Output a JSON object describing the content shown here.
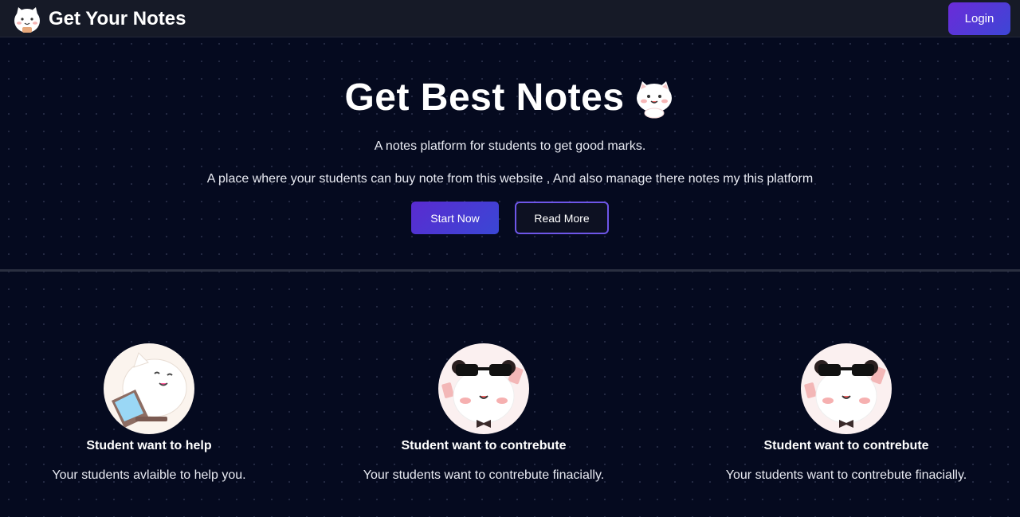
{
  "navbar": {
    "brand_title": "Get Your Notes",
    "logo_icon": "cat-mascot-icon",
    "login_label": "Login"
  },
  "hero": {
    "title": "Get Best Notes",
    "title_icon": "cat-mascot-icon",
    "subtitle_1": "A notes platform for students to get good marks.",
    "subtitle_2": "A place where your students can buy note from this website , And also manage there notes my this platform",
    "start_label": "Start Now",
    "read_more_label": "Read More"
  },
  "features": [
    {
      "icon": "cat-laptop-icon",
      "title": "Student want to help",
      "desc": "Your students avlaible to help you."
    },
    {
      "icon": "panda-sunglasses-icon",
      "title": "Student want to contrebute",
      "desc": "Your students want to contrebute finacially."
    },
    {
      "icon": "panda-sunglasses-icon",
      "title": "Student want to contrebute",
      "desc": "Your students want to contrebute finacially."
    }
  ],
  "colors": {
    "background": "#050a1f",
    "navbar": "#161a27",
    "accent_start": "#5a2bd0",
    "accent_end": "#3a47d5",
    "outline": "#6e56e8"
  }
}
